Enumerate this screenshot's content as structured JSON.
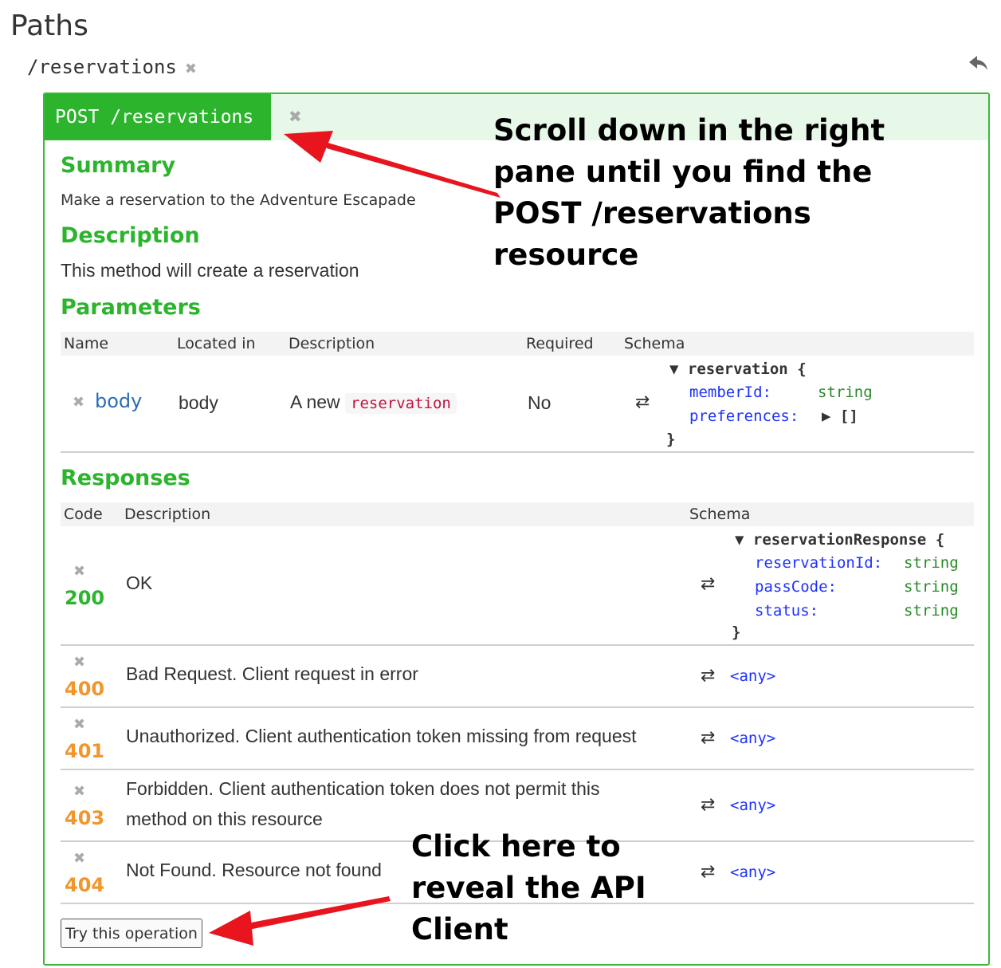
{
  "page": {
    "title": "Paths"
  },
  "path": {
    "label": "/reservations",
    "delete_glyph": "✖"
  },
  "operation": {
    "badge": "POST /reservations",
    "delete_glyph": "✖"
  },
  "summary": {
    "heading": "Summary",
    "text": "Make a reservation to the Adventure Escapade"
  },
  "description": {
    "heading": "Description",
    "text": "This method will create a reservation"
  },
  "parameters": {
    "heading": "Parameters",
    "columns": [
      "Name",
      "Located in",
      "Description",
      "Required",
      "Schema"
    ],
    "rows": [
      {
        "name": "body",
        "located_in": "body",
        "description_prefix": "A new",
        "description_tag": "reservation",
        "required": "No",
        "schema": {
          "title": "reservation",
          "open_brace": "{",
          "close_brace": "}",
          "props": [
            {
              "name": "memberId:",
              "type": "string"
            },
            {
              "name": "preferences:",
              "type": "[]"
            }
          ]
        }
      }
    ]
  },
  "responses": {
    "heading": "Responses",
    "columns": [
      "Code",
      "Description",
      "Schema"
    ],
    "rows": [
      {
        "code": "200",
        "description": "OK",
        "schema": {
          "title": "reservationResponse",
          "open_brace": "{",
          "close_brace": "}",
          "props": [
            {
              "name": "reservationId:",
              "type": "string"
            },
            {
              "name": "passCode:",
              "type": "string"
            },
            {
              "name": "status:",
              "type": "string"
            }
          ]
        }
      },
      {
        "code": "400",
        "description": "Bad Request. Client request in error",
        "schema_link": "<any>"
      },
      {
        "code": "401",
        "description": "Unauthorized. Client authentication token missing from request",
        "schema_link": "<any>"
      },
      {
        "code": "403",
        "description_line1": "Forbidden. Client authentication token does not permit this",
        "description_line2": "method on this resource",
        "schema_link": "<any>"
      },
      {
        "code": "404",
        "description": "Not Found. Resource not found",
        "schema_link": "<any>"
      }
    ]
  },
  "try_button": {
    "label": "Try this operation"
  },
  "callouts": {
    "top": [
      "Scroll down in the right",
      "pane until you find the",
      "POST /reservations",
      "resource"
    ],
    "bottom": [
      "Click here to",
      "reveal the API",
      "Client"
    ]
  },
  "glyphs": {
    "swap": "⇄",
    "expand_open": "▼",
    "expand_closed": "▶"
  },
  "colors": {
    "success": "#2db42d",
    "client_error": "#f0962d",
    "link": "#1e32ff",
    "type": "#2a8a2a",
    "arrow": "#e8141e"
  }
}
